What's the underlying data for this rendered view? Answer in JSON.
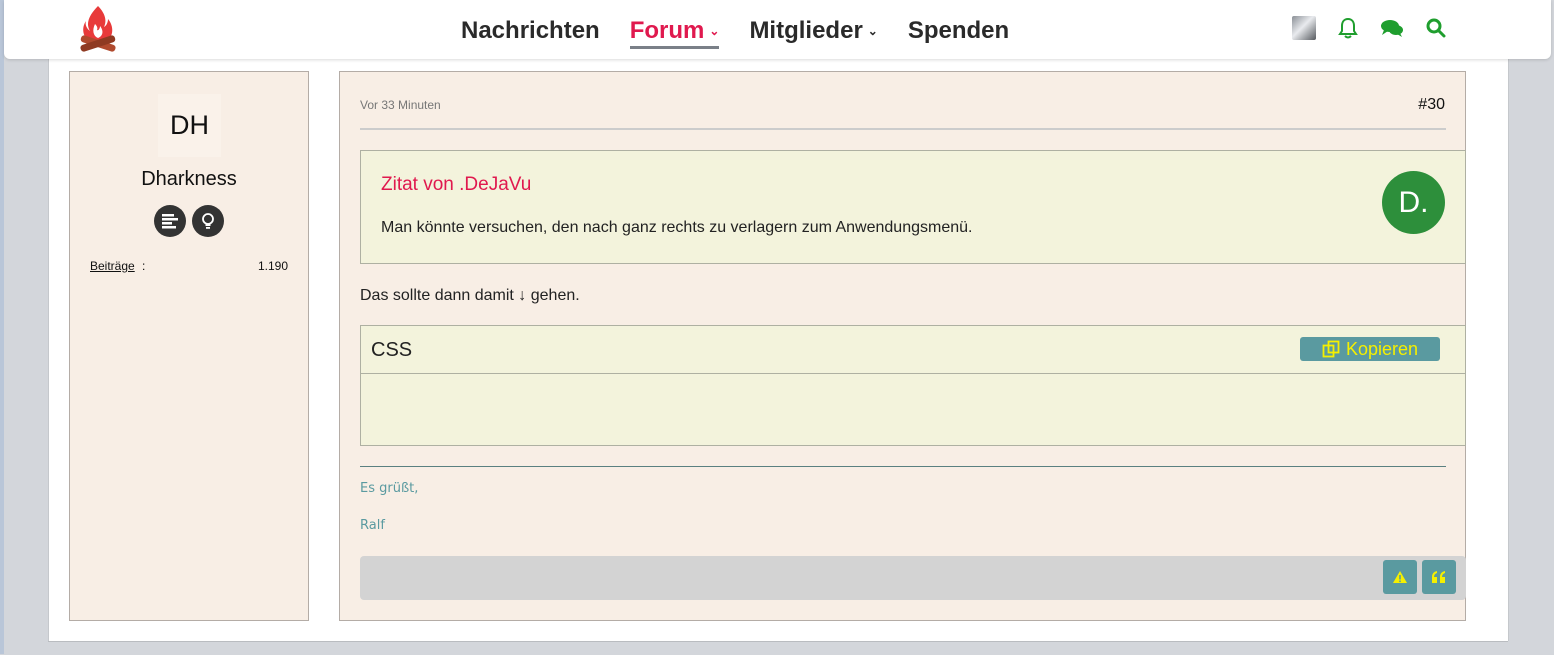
{
  "nav": {
    "items": [
      {
        "label": "Nachrichten"
      },
      {
        "label": "Forum",
        "caret": "⌄"
      },
      {
        "label": "Mitglieder",
        "caret": "⌄"
      },
      {
        "label": "Spenden"
      }
    ],
    "active_color": "#e0194e"
  },
  "header_icons": [
    "user-avatar",
    "bell-icon",
    "chat-icon",
    "search-icon"
  ],
  "user": {
    "initials": "DH",
    "name": "Dharkness",
    "stat_label": "Beiträge",
    "stat_value": "1.190"
  },
  "post": {
    "time": "Vor 33 Minuten",
    "number": "#30",
    "quote": {
      "title": "Zitat von .DeJaVu",
      "text": "Man könnte versuchen, den nach ganz rechts zu verlagern zum Anwendungsmenü.",
      "avatar_initials": "D."
    },
    "text": "Das sollte dann damit ↓ gehen.",
    "code": {
      "language": "CSS",
      "copy_label": "Kopieren"
    },
    "signature": [
      "Es grüßt,",
      "Ralf"
    ]
  },
  "colors": {
    "accent_red": "#e0194e",
    "teal": "#5a9aa0",
    "green": "#2d8f3b",
    "card_bg": "#f8eee5"
  }
}
